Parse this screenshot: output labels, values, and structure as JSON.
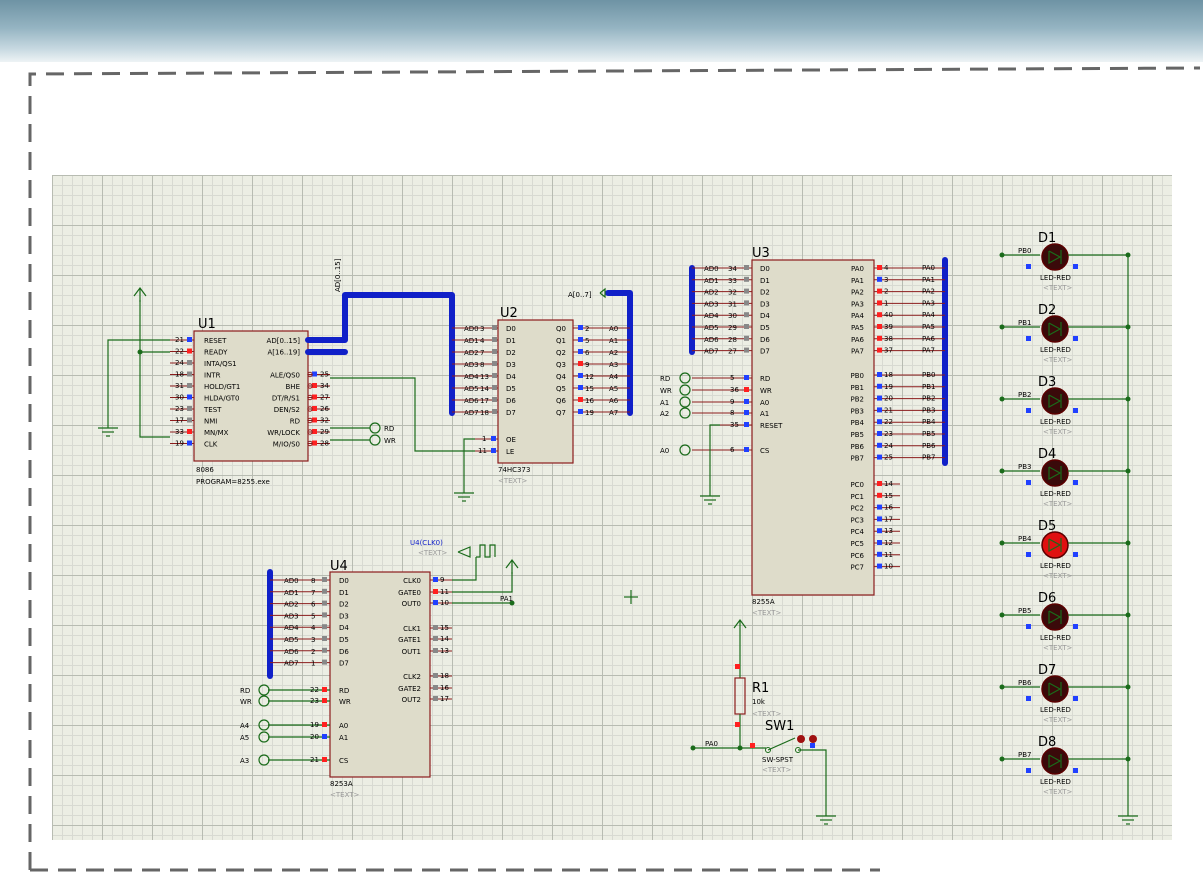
{
  "u1": {
    "ref": "U1",
    "part": "8086",
    "program": "PROGRAM=8255.exe",
    "left_pins": [
      {
        "num": "21",
        "name": "RESET",
        "color": "#2040ff"
      },
      {
        "num": "22",
        "name": "READY",
        "color": "#ff2020"
      },
      {
        "num": "24",
        "name": "INTA/QS1",
        "color": "#888888"
      },
      {
        "num": "18",
        "name": "INTR",
        "color": "#888888"
      },
      {
        "num": "31",
        "name": "HOLD/GT1",
        "color": "#888888"
      },
      {
        "num": "30",
        "name": "HLDA/GT0",
        "color": "#2040ff"
      },
      {
        "num": "23",
        "name": "TEST",
        "color": "#888888"
      },
      {
        "num": "17",
        "name": "NMI",
        "color": "#888888"
      },
      {
        "num": "33",
        "name": "MN/MX",
        "color": "#ff2020"
      },
      {
        "num": "19",
        "name": "CLK",
        "color": "#2040ff"
      }
    ],
    "right_pins": [
      {
        "num": "",
        "name": "AD[0..15]"
      },
      {
        "num": "",
        "name": "A[16..19]"
      },
      {
        "num": "",
        "name": ""
      },
      {
        "num": "25",
        "name": "ALE/QS0"
      },
      {
        "num": "34",
        "name": "BHE"
      },
      {
        "num": "27",
        "name": "DT/R/S1"
      },
      {
        "num": "26",
        "name": "DEN/S2"
      },
      {
        "num": "32",
        "name": "RD"
      },
      {
        "num": "29",
        "name": "WR/LOCK"
      },
      {
        "num": "28",
        "name": "M/IO/S0"
      }
    ],
    "rd_label": "RD",
    "wr_label": "WR"
  },
  "u2": {
    "ref": "U2",
    "part": "74HC373",
    "text": "<TEXT>",
    "inputs": [
      "AD0",
      "AD1",
      "AD2",
      "AD3",
      "AD4",
      "AD5",
      "AD6",
      "AD7"
    ],
    "input_nums": [
      "3",
      "4",
      "7",
      "8",
      "13",
      "14",
      "17",
      "18"
    ],
    "d_pins": [
      "D0",
      "D1",
      "D2",
      "D3",
      "D4",
      "D5",
      "D6",
      "D7"
    ],
    "q_pins": [
      "Q0",
      "Q1",
      "Q2",
      "Q3",
      "Q4",
      "Q5",
      "Q6",
      "Q7"
    ],
    "output_nums": [
      "2",
      "5",
      "6",
      "9",
      "12",
      "15",
      "16",
      "19"
    ],
    "outputs": [
      "A0",
      "A1",
      "A2",
      "A3",
      "A4",
      "A5",
      "A6",
      "A7"
    ],
    "oe": {
      "num": "1",
      "name": "OE"
    },
    "le": {
      "num": "11",
      "name": "LE"
    },
    "bus_label": "AD[0..15]",
    "out_bus_label": "A[0..7]"
  },
  "u3": {
    "ref": "U3",
    "part": "8255A",
    "text": "<TEXT>",
    "d_inputs": [
      "AD0",
      "AD1",
      "AD2",
      "AD3",
      "AD4",
      "AD5",
      "AD6",
      "AD7"
    ],
    "d_nums": [
      "34",
      "33",
      "32",
      "31",
      "30",
      "29",
      "28",
      "27"
    ],
    "d_pins": [
      "D0",
      "D1",
      "D2",
      "D3",
      "D4",
      "D5",
      "D6",
      "D7"
    ],
    "ctrl": [
      {
        "label": "RD",
        "num": "5",
        "pin": "RD"
      },
      {
        "label": "WR",
        "num": "36",
        "pin": "WR"
      },
      {
        "label": "A1",
        "num": "9",
        "pin": "A0"
      },
      {
        "label": "A2",
        "num": "8",
        "pin": "A1"
      },
      {
        "label": "",
        "num": "35",
        "pin": "RESET"
      },
      {
        "label": "A0",
        "num": "6",
        "pin": "CS"
      }
    ],
    "pa_pins": [
      "PA0",
      "PA1",
      "PA2",
      "PA3",
      "PA4",
      "PA5",
      "PA6",
      "PA7"
    ],
    "pa_nums": [
      "4",
      "3",
      "2",
      "1",
      "40",
      "39",
      "38",
      "37"
    ],
    "pa_nets": [
      "PA0",
      "PA1",
      "PA2",
      "PA3",
      "PA4",
      "PA5",
      "PA6",
      "PA7"
    ],
    "pb_pins": [
      "PB0",
      "PB1",
      "PB2",
      "PB3",
      "PB4",
      "PB5",
      "PB6",
      "PB7"
    ],
    "pb_nums": [
      "18",
      "19",
      "20",
      "21",
      "22",
      "23",
      "24",
      "25"
    ],
    "pb_nets": [
      "PB0",
      "PB1",
      "PB2",
      "PB3",
      "PB4",
      "PB5",
      "PB6",
      "PB7"
    ],
    "pc_pins": [
      "PC0",
      "PC1",
      "PC2",
      "PC3",
      "PC4",
      "PC5",
      "PC6",
      "PC7"
    ],
    "pc_nums": [
      "14",
      "15",
      "16",
      "17",
      "13",
      "12",
      "11",
      "10"
    ]
  },
  "u4": {
    "ref": "U4",
    "part": "8253A",
    "text": "<TEXT>",
    "d_inputs": [
      "AD0",
      "AD1",
      "AD2",
      "AD3",
      "AD4",
      "AD5",
      "AD6",
      "AD7"
    ],
    "d_nums": [
      "8",
      "7",
      "6",
      "5",
      "4",
      "3",
      "2",
      "1"
    ],
    "d_pins": [
      "D0",
      "D1",
      "D2",
      "D3",
      "D4",
      "D5",
      "D6",
      "D7"
    ],
    "ctrl": [
      {
        "label": "RD",
        "num": "22",
        "pin": "RD"
      },
      {
        "label": "WR",
        "num": "23",
        "pin": "WR"
      },
      {
        "label": "A4",
        "num": "19",
        "pin": "A0"
      },
      {
        "label": "A5",
        "num": "20",
        "pin": "A1"
      },
      {
        "label": "A3",
        "num": "21",
        "pin": "CS"
      }
    ],
    "right": [
      {
        "pin": "CLK0",
        "num": "9"
      },
      {
        "pin": "GATE0",
        "num": "11"
      },
      {
        "pin": "OUT0",
        "num": "10"
      },
      {
        "pin": "CLK1",
        "num": "15"
      },
      {
        "pin": "GATE1",
        "num": "14"
      },
      {
        "pin": "OUT1",
        "num": "13"
      },
      {
        "pin": "CLK2",
        "num": "18"
      },
      {
        "pin": "GATE2",
        "num": "16"
      },
      {
        "pin": "OUT2",
        "num": "17"
      }
    ],
    "clk_gen": "U4(CLK0)",
    "clk_text": "<TEXT>",
    "out_net": "PA1"
  },
  "r1": {
    "ref": "R1",
    "value": "10k",
    "text": "<TEXT>"
  },
  "sw1": {
    "ref": "SW1",
    "part": "SW-SPST",
    "text": "<TEXT>",
    "net": "PA0"
  },
  "leds": [
    {
      "ref": "D1",
      "net": "PB0",
      "part": "LED-RED",
      "text": "<TEXT>",
      "lit": false
    },
    {
      "ref": "D2",
      "net": "PB1",
      "part": "LED-RED",
      "text": "<TEXT>",
      "lit": false
    },
    {
      "ref": "D3",
      "net": "PB2",
      "part": "LED-RED",
      "text": "<TEXT>",
      "lit": false
    },
    {
      "ref": "D4",
      "net": "PB3",
      "part": "LED-RED",
      "text": "<TEXT>",
      "lit": false
    },
    {
      "ref": "D5",
      "net": "PB4",
      "part": "LED-RED",
      "text": "<TEXT>",
      "lit": true
    },
    {
      "ref": "D6",
      "net": "PB5",
      "part": "LED-RED",
      "text": "<TEXT>",
      "lit": false
    },
    {
      "ref": "D7",
      "net": "PB6",
      "part": "LED-RED",
      "text": "<TEXT>",
      "lit": false
    },
    {
      "ref": "D8",
      "net": "PB7",
      "part": "LED-RED",
      "text": "<TEXT>",
      "lit": false
    }
  ],
  "colors": {
    "chip_fill": "#dedcca",
    "chip_border": "#8b1c1c",
    "wire": "#1a6b1a",
    "bus": "#1020c8",
    "led_on": "#e01010",
    "led_off": "#3a0a0a",
    "grid_bg": "#eceee4"
  }
}
